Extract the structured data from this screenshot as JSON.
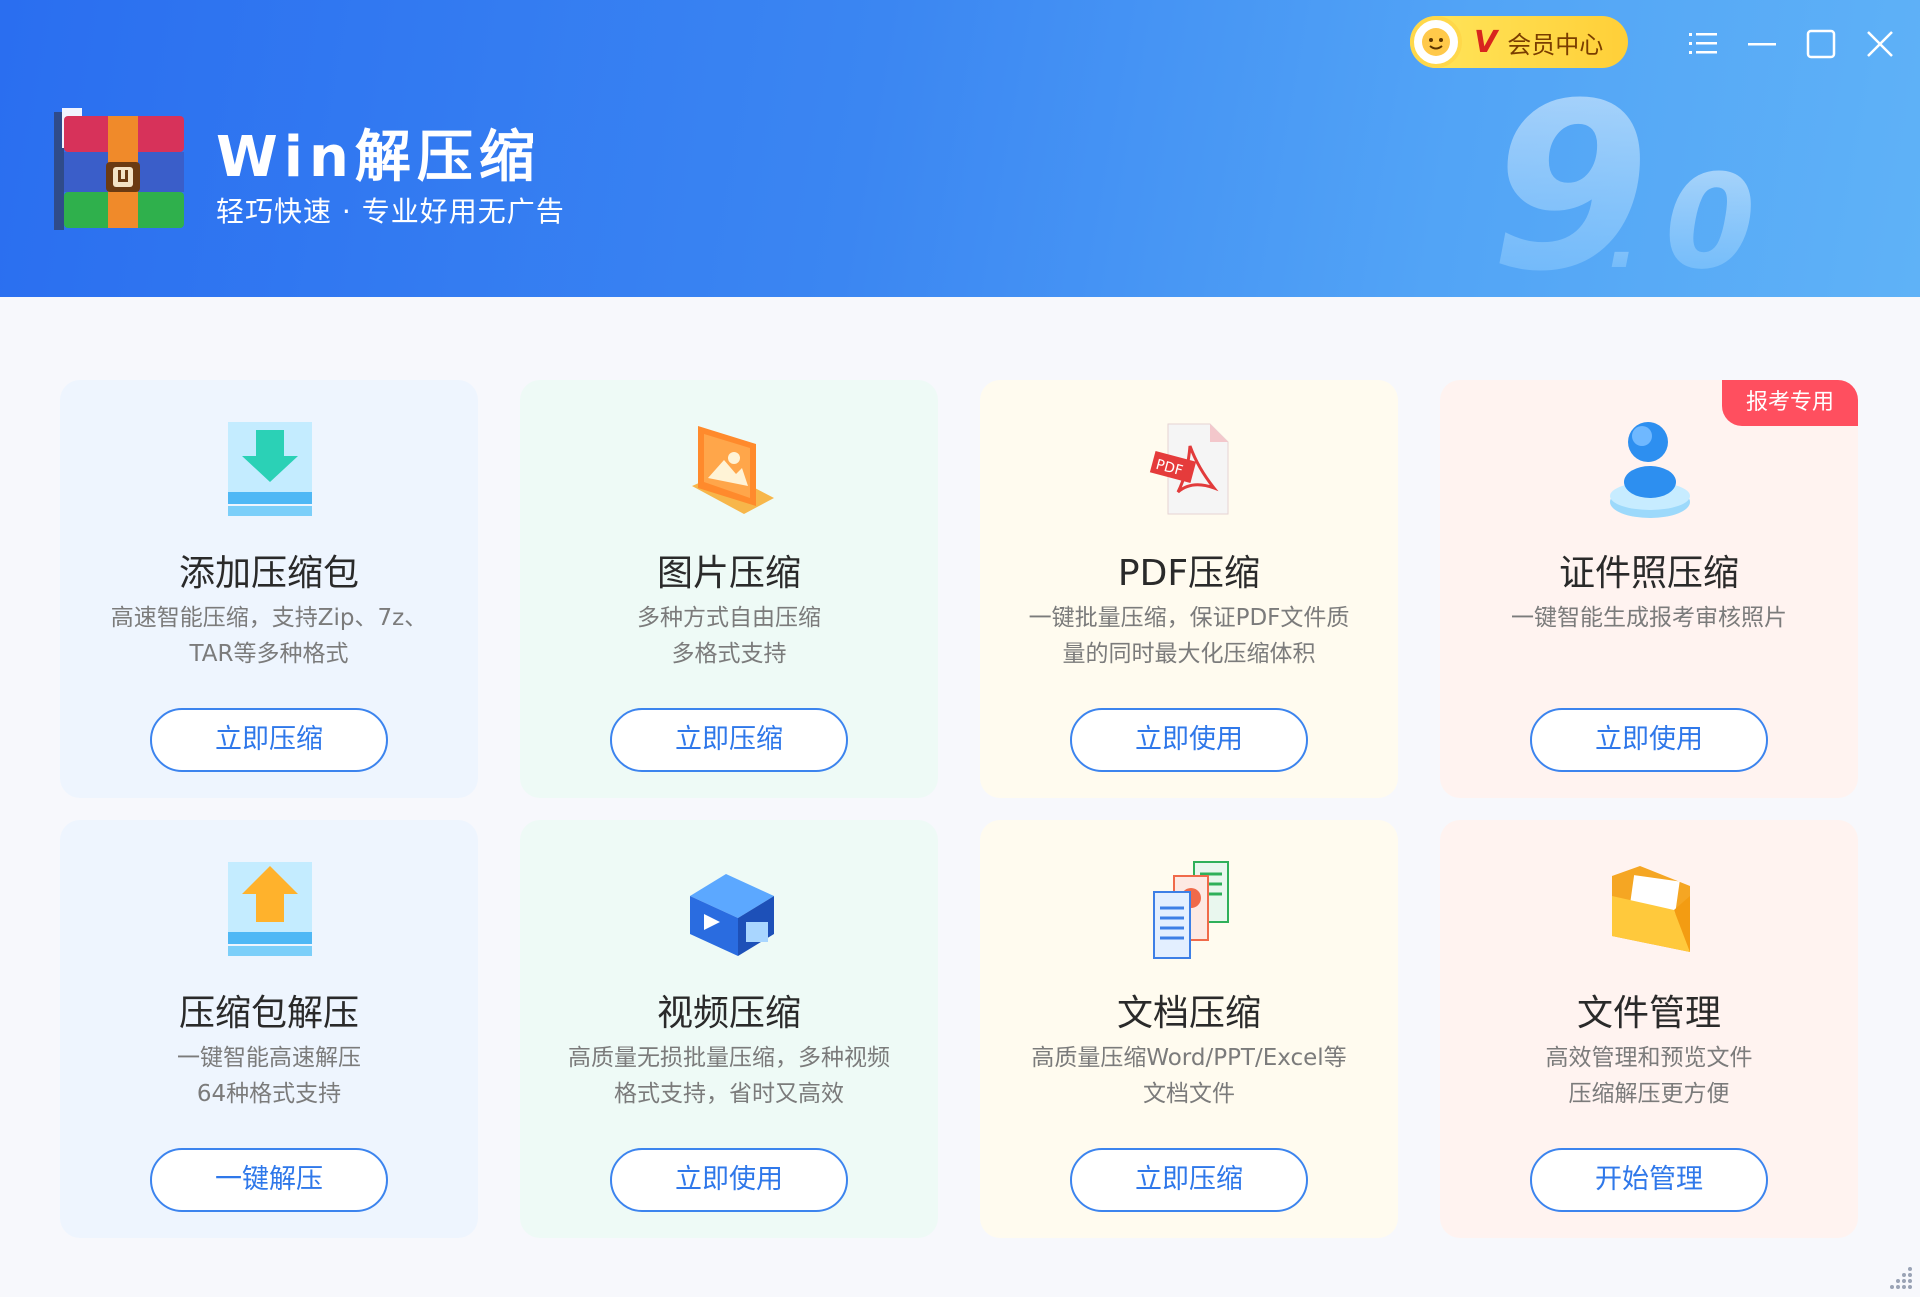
{
  "header": {
    "title": "Win解压缩",
    "subtitle": "轻巧快速 · 专业好用无广告",
    "version": "9.0",
    "vip_label": "会员中心",
    "vip_v": "V"
  },
  "window_controls": [
    "menu-icon",
    "minimize-icon",
    "maximize-icon",
    "close-icon"
  ],
  "cards": [
    {
      "title": "添加压缩包",
      "desc_1": "高速智能压缩，支持Zip、7z、",
      "desc_2": "TAR等多种格式",
      "button": "立即压缩",
      "bg": "#eef5fe",
      "icon": "download-box-icon"
    },
    {
      "title": "图片压缩",
      "desc_1": "多种方式自由压缩",
      "desc_2": "多格式支持",
      "button": "立即压缩",
      "bg": "#eefaf6",
      "icon": "image-icon"
    },
    {
      "title": "PDF压缩",
      "desc_1": "一键批量压缩，保证PDF文件质",
      "desc_2": "量的同时最大化压缩体积",
      "button": "立即使用",
      "bg": "#fffbef",
      "icon": "pdf-icon"
    },
    {
      "title": "证件照压缩",
      "desc_1": "一键智能生成报考审核照片",
      "desc_2": "",
      "button": "立即使用",
      "bg": "#fff3f0",
      "icon": "id-photo-icon",
      "badge": "报考专用"
    },
    {
      "title": "压缩包解压",
      "desc_1": "一键智能高速解压",
      "desc_2": "64种格式支持",
      "button": "一键解压",
      "bg": "#eef5fe",
      "icon": "upload-box-icon"
    },
    {
      "title": "视频压缩",
      "desc_1": "高质量无损批量压缩，多种视频",
      "desc_2": "格式支持，省时又高效",
      "button": "立即使用",
      "bg": "#eefaf6",
      "icon": "video-icon"
    },
    {
      "title": "文档压缩",
      "desc_1": "高质量压缩Word/PPT/Excel等",
      "desc_2": "文档文件",
      "button": "立即压缩",
      "bg": "#fffbef",
      "icon": "documents-icon"
    },
    {
      "title": "文件管理",
      "desc_1": "高效管理和预览文件",
      "desc_2": "压缩解压更方便",
      "button": "开始管理",
      "bg": "#fff3f0",
      "icon": "folder-icon"
    }
  ],
  "colors": {
    "accent": "#2f78ea",
    "badge": "#ff4f5f",
    "header_start": "#2a6ef0",
    "header_end": "#5fb2f7"
  }
}
